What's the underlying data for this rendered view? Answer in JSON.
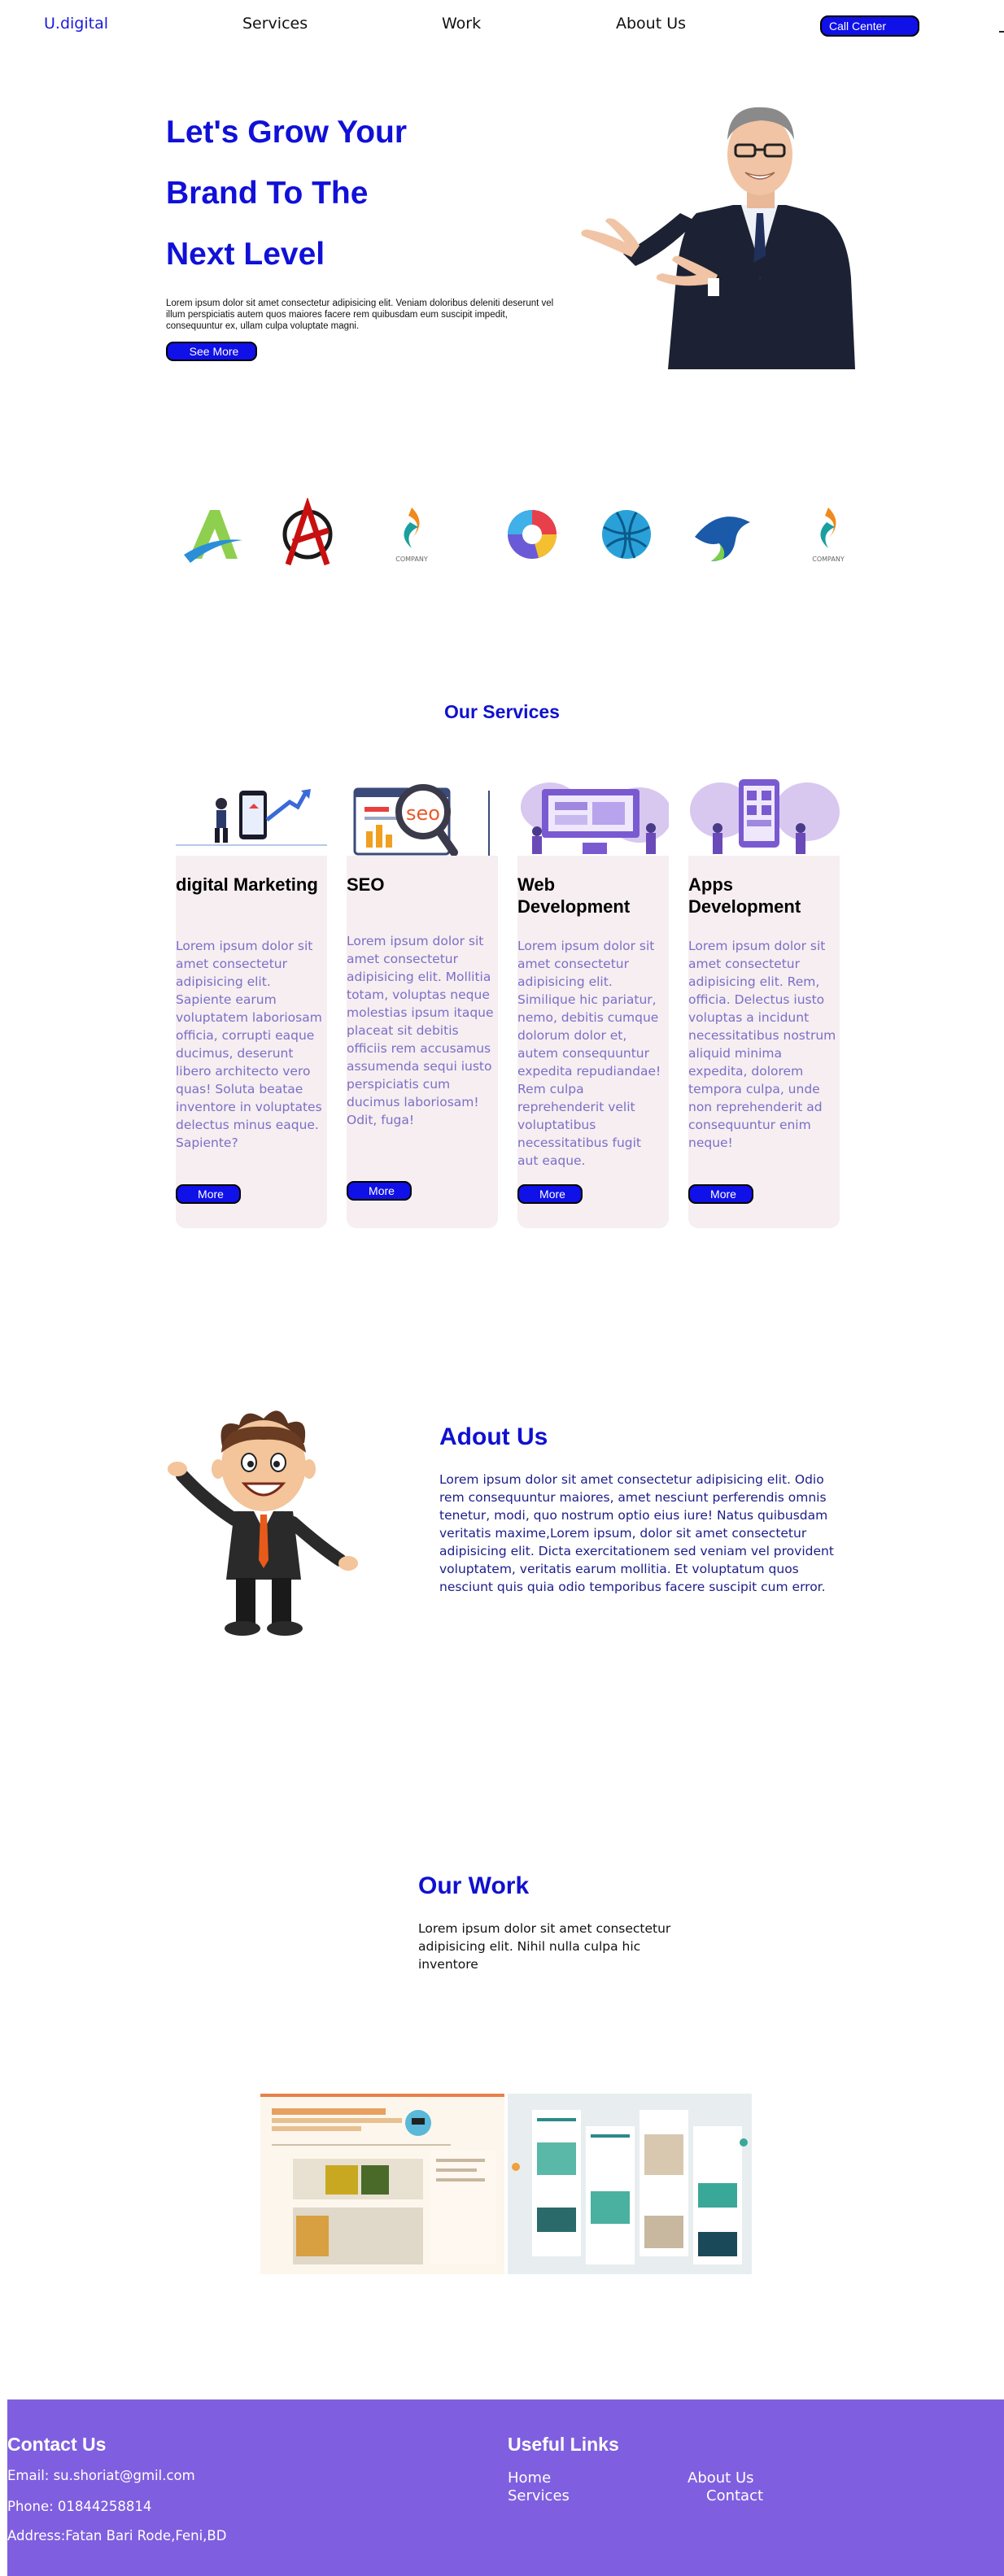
{
  "nav": {
    "logo": "U.digital",
    "links": [
      "Services",
      "Work",
      "About Us"
    ],
    "call_button": "Call Center"
  },
  "hero": {
    "title_lines": [
      "Let's Grow Your",
      "Brand To The",
      "Next Level"
    ],
    "text": "Lorem ipsum dolor sit amet consectetur adipisicing elit. Veniam doloribus deleniti deserunt vel illum perspiciatis autem quos maiores facere rem quibusdam eum suscipit impedit, consequuntur ex, ullam culpa voluptate magni.",
    "button": "See More"
  },
  "logos": {
    "items": [
      "letter-a-logo",
      "anarchy-a-logo",
      "company-flame-logo",
      "colorful-sphere-logo",
      "blue-ball-logo",
      "blue-bird-logo",
      "company-flame-logo"
    ],
    "company_label": "COMPANY"
  },
  "services": {
    "title": "Our Services",
    "cards": [
      {
        "title": "digital Marketing",
        "text": "Lorem ipsum dolor sit amet consectetur adipisicing elit. Sapiente earum voluptatem laboriosam officia, corrupti eaque ducimus, deserunt libero architecto vero quas! Soluta beatae inventore in voluptates delectus minus eaque. Sapiente?",
        "button": "More"
      },
      {
        "title": "SEO",
        "text": "Lorem ipsum dolor sit amet consectetur adipisicing elit. Mollitia totam, voluptas neque molestias ipsum itaque placeat sit debitis officiis rem accusamus assumenda sequi iusto perspiciatis cum ducimus laboriosam! Odit, fuga!",
        "button": "More",
        "badge": "seo"
      },
      {
        "title": "Web Development",
        "text": "Lorem ipsum dolor sit amet consectetur adipisicing elit. Similique hic pariatur, nemo, debitis cumque dolorum dolor et, autem consequuntur expedita repudiandae! Rem culpa reprehenderit velit voluptatibus necessitatibus fugit aut eaque.",
        "button": "More"
      },
      {
        "title": "Apps Development",
        "text": "Lorem ipsum dolor sit amet consectetur adipisicing elit. Rem, officia. Delectus iusto voluptas a incidunt necessitatibus nostrum aliquid minima expedita, dolorem tempora culpa, unde non reprehenderit ad consequuntur enim neque!",
        "button": "More"
      }
    ]
  },
  "about": {
    "title": "Adout Us",
    "text": "Lorem ipsum dolor sit amet consectetur adipisicing elit. Odio rem consequuntur maiores, amet nesciunt perferendis omnis tenetur, modi, quo nostrum optio eius iure! Natus quibusdam veritatis maxime,Lorem ipsum, dolor sit amet consectetur adipisicing elit. Dicta exercitationem sed veniam vel provident voluptatem, veritatis earum mollitia. Et voluptatum quos nesciunt quis quia odio temporibus facere suscipit cum error."
  },
  "work": {
    "title": "Our Work",
    "text": "Lorem ipsum dolor sit amet consectetur adipisicing elit. Nihil nulla culpa hic inventore"
  },
  "footer": {
    "contact_title": "Contact Us",
    "email": "Email: su.shoriat@gmil.com",
    "phone": "Phone: 01844258814",
    "address": "Address:Fatan Bari Rode,Feni,BD",
    "links_title": "Useful Links",
    "links": [
      "Home",
      "Services",
      "About Us",
      "Contact"
    ]
  },
  "colors": {
    "primary_blue": "#1010e8",
    "footer_purple": "#7f5fdf",
    "card_bg": "#f6eef0",
    "card_text": "#7a6fc8"
  }
}
